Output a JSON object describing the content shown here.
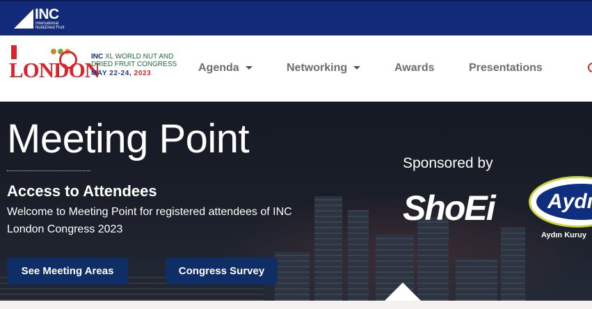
{
  "topbar": {
    "logo_text": "INC",
    "logo_sub": "International Nut&Dried Fruit"
  },
  "congress_logo": {
    "city": "LONDON",
    "title_prefix": "INC",
    "title": "XL WORLD NUT AND DRIED FRUIT CONGRESS",
    "date_main": "MAY 22-24,",
    "date_year": "2023"
  },
  "nav": {
    "items": [
      {
        "label": "Agenda",
        "has_dropdown": true
      },
      {
        "label": "Networking",
        "has_dropdown": true
      },
      {
        "label": "Awards",
        "has_dropdown": false
      },
      {
        "label": "Presentations",
        "has_dropdown": false
      }
    ]
  },
  "hero": {
    "title": "Meeting Point",
    "subtitle": "Access to Attendees",
    "description": "Welcome to Meeting Point for registered attendees of INC London Congress 2023",
    "buttons": {
      "meeting_areas": "See Meeting Areas",
      "survey": "Congress Survey"
    },
    "sponsored_by": "Sponsored by",
    "sponsors": {
      "shoei": "ShoEi",
      "aydin": "Aydı",
      "aydin_caption": "Aydın Kuruy"
    }
  },
  "colors": {
    "topbar": "#132a78",
    "brand_red": "#d9262c",
    "button_bg": "#102e66",
    "nav_text": "#6d6d6d"
  },
  "icons": {
    "dropdown": "chevron-down-icon",
    "scroll_up": "triangle-up-icon"
  }
}
